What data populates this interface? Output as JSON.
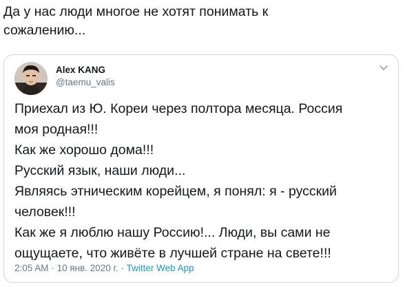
{
  "caption": {
    "text": "Да у нас люди многое не хотят понимать к\nсожалению..."
  },
  "tweet": {
    "author_name": "Alex KANG",
    "author_handle": "@taemu_valis",
    "lines": [
      "Приехал из Ю. Кореи через полтора месяца. Россия",
      "моя родная!!!",
      "Как же хорошо дома!!!",
      "Русский язык, наши люди...",
      "Являясь этническим корейцем, я понял: я - русский",
      "человек!!!",
      "Как же я люблю нашу Россию!... Люди, вы сами не",
      "ощущаете, что живёте в лучшей стране на свете!!!"
    ],
    "time": "2:05 AM",
    "separator": "·",
    "date": "10 янв. 2020 г.",
    "source": "Twitter Web App"
  },
  "colors": {
    "text": "#14171a",
    "secondary": "#657786",
    "link": "#1b95e0",
    "border": "#ccd6dd"
  },
  "icons": {
    "menu_caret": "chevron-down-icon"
  }
}
